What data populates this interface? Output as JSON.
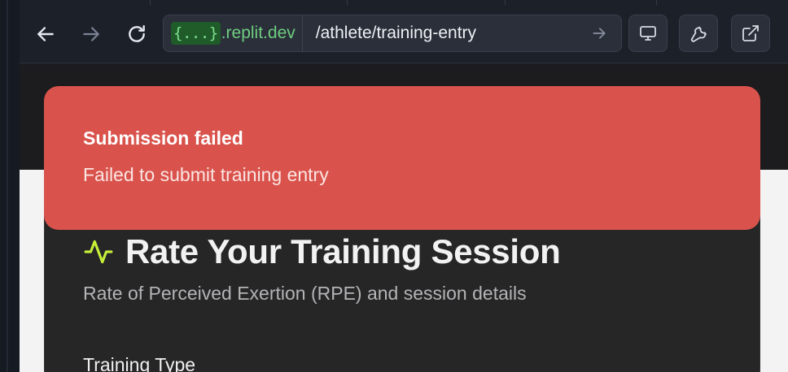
{
  "browser": {
    "url_badge": "{...}",
    "url_host": ".replit.dev",
    "url_path": "/athlete/training-entry",
    "icons": {
      "back": "arrow-left-icon",
      "forward": "arrow-right-icon",
      "reload": "reload-icon",
      "go": "go-arrow-icon",
      "devtools": "monitor-icon",
      "tools": "wrench-icon",
      "open_external": "external-link-icon"
    }
  },
  "toast": {
    "title": "Submission failed",
    "message": "Failed to submit training entry",
    "color": "#d9534c"
  },
  "card": {
    "icon": "activity-icon",
    "icon_color": "#c6ef3a",
    "title": "Rate Your Training Session",
    "subtitle": "Rate of Perceived Exertion (RPE) and session details",
    "field_label": "Training Type"
  }
}
